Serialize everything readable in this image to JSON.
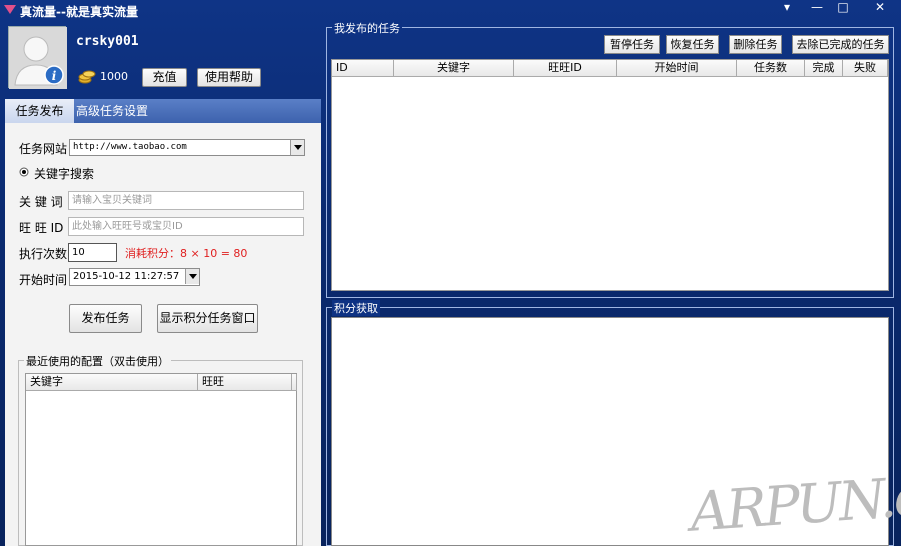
{
  "app": {
    "title": "真流量--就是真实流量"
  },
  "window_controls": {
    "menu": "▾",
    "minimize": "—",
    "maximize": "□",
    "close": "✕"
  },
  "user": {
    "name": "crsky001",
    "credits": "1000"
  },
  "header_buttons": {
    "recharge": "充值",
    "help": "使用帮助"
  },
  "tabs": [
    {
      "label": "任务发布"
    },
    {
      "label": "高级任务设置"
    }
  ],
  "form": {
    "site_label": "任务网站",
    "site_value": "http://www.taobao.com",
    "radio_label": "关键字搜索",
    "keyword_label": "关 键 词",
    "keyword_placeholder": "请输入宝贝关键词",
    "wangwang_label": "旺 旺 ID",
    "wangwang_placeholder": "此处输入旺旺号或宝贝ID",
    "exec_label": "执行次数",
    "exec_value": "10",
    "cost_text": "消耗积分：8 × 10 = 80",
    "start_label": "开始时间",
    "start_value": "2015-10-12 11:27:57",
    "publish_button": "发布任务",
    "show_window_button": "显示积分任务窗口"
  },
  "recent": {
    "title": "最近使用的配置（双击使用）",
    "columns": [
      "关键字",
      "旺旺"
    ]
  },
  "my_tasks": {
    "title": "我发布的任务",
    "buttons": [
      "暂停任务",
      "恢复任务",
      "删除任务",
      "去除已完成的任务"
    ],
    "columns": [
      "ID",
      "关键字",
      "旺旺ID",
      "开始时间",
      "任务数",
      "完成",
      "失败"
    ]
  },
  "points": {
    "title": "积分获取"
  },
  "watermark": "ARPUN.com",
  "colors": {
    "accent": "#0f3486",
    "cost_text": "#e02020"
  }
}
